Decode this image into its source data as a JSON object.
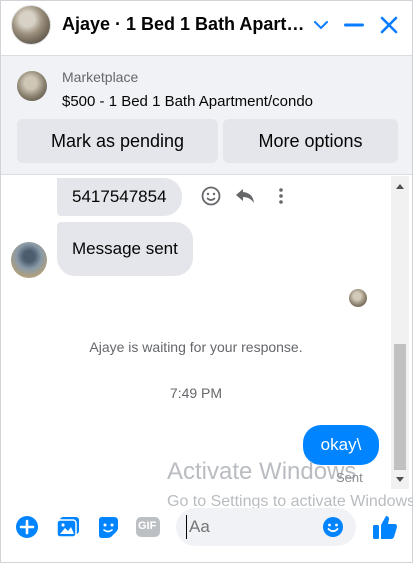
{
  "header": {
    "title": "Ajaye · 1 Bed 1 Bath Apart…",
    "icons": [
      "chevron-down-icon",
      "minimize-icon",
      "close-icon"
    ]
  },
  "marketplace": {
    "label": "Marketplace",
    "listing": "$500 - 1 Bed 1 Bath Apartment/condo",
    "buttons": {
      "pending": "Mark as pending",
      "more": "More options"
    }
  },
  "messages": {
    "first": "5417547854",
    "second": "Message sent",
    "waiting": "Ajaye is waiting for your response.",
    "time": "7:49 PM",
    "outgoing": "okay\\",
    "status": "Sent"
  },
  "watermark": {
    "line1": "Activate Windows",
    "line2": "Go to Settings to activate Windows."
  },
  "composer": {
    "placeholder": "Aa",
    "gif": "GIF"
  },
  "colors": {
    "accent": "#0084ff",
    "header_icons": "#0a7cff",
    "incoming_bubble": "#e4e6eb"
  }
}
